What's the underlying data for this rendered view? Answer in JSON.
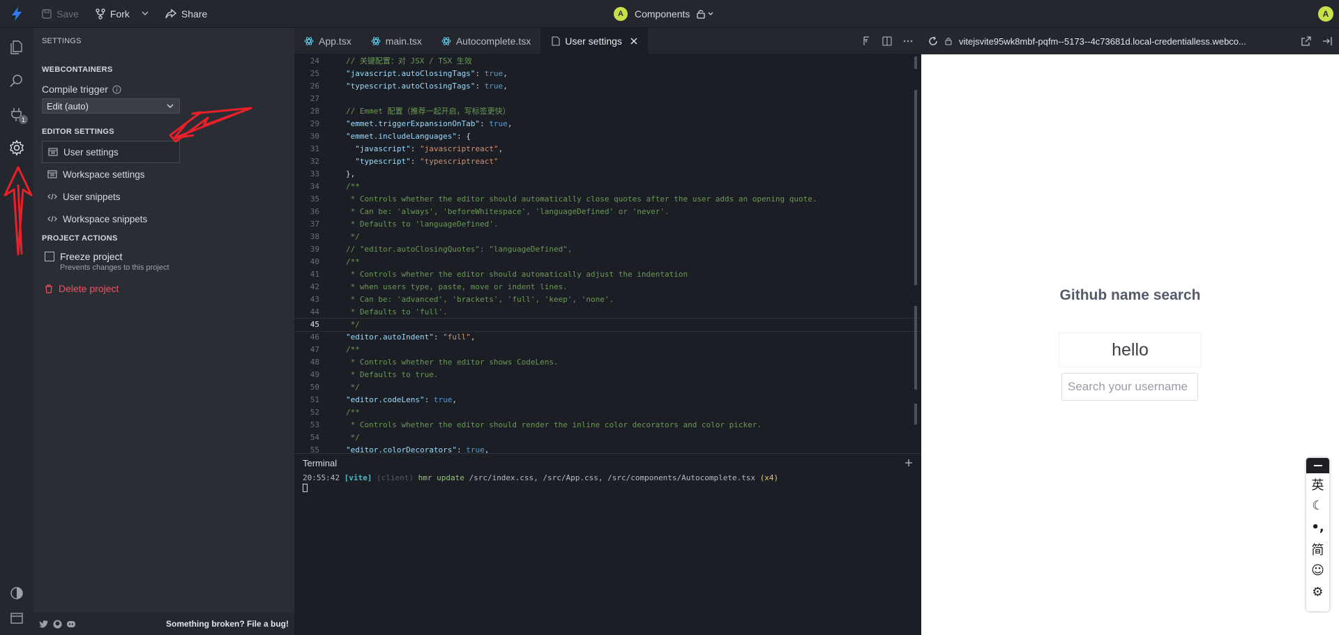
{
  "topbar": {
    "save_label": "Save",
    "fork_label": "Fork",
    "share_label": "Share",
    "project_avatar": "A",
    "project_name": "Components",
    "user_avatar": "A"
  },
  "activity": {
    "extensions_badge": "1"
  },
  "sidebar": {
    "title": "SETTINGS",
    "webcontainers_heading": "WEBCONTAINERS",
    "compile_trigger_label": "Compile trigger",
    "compile_trigger_value": "Edit (auto)",
    "editor_settings_heading": "EDITOR SETTINGS",
    "items": [
      {
        "label": "User settings"
      },
      {
        "label": "Workspace settings"
      },
      {
        "label": "User snippets"
      },
      {
        "label": "Workspace snippets"
      }
    ],
    "project_actions_heading": "PROJECT ACTIONS",
    "freeze_label": "Freeze project",
    "freeze_desc": "Prevents changes to this project",
    "delete_label": "Delete project",
    "footer_bug": "Something broken? File a bug!"
  },
  "tabs": [
    {
      "label": "App.tsx"
    },
    {
      "label": "main.tsx"
    },
    {
      "label": "Autocomplete.tsx"
    },
    {
      "label": "User settings"
    }
  ],
  "code_lines": [
    {
      "n": "24",
      "html": "<span class=\"c-com\">// 关键配置：对 JSX / TSX 生效</span>"
    },
    {
      "n": "25",
      "html": "<span class=\"c-key\">\"javascript.autoClosingTags\"</span>: <span class=\"c-bool\">true</span>,"
    },
    {
      "n": "26",
      "html": "<span class=\"c-key\">\"typescript.autoClosingTags\"</span>: <span class=\"c-bool\">true</span>,"
    },
    {
      "n": "27",
      "html": ""
    },
    {
      "n": "28",
      "html": "<span class=\"c-com\">// Emmet 配置（推荐一起开启，写标签更快）</span>"
    },
    {
      "n": "29",
      "html": "<span class=\"c-key\">\"emmet.triggerExpansionOnTab\"</span>: <span class=\"c-bool\">true</span>,"
    },
    {
      "n": "30",
      "html": "<span class=\"c-key\">\"emmet.includeLanguages\"</span>: {"
    },
    {
      "n": "31",
      "html": "  <span class=\"c-key\">\"javascript\"</span>: <span class=\"c-str\">\"javascriptreact\"</span>,"
    },
    {
      "n": "32",
      "html": "  <span class=\"c-key\">\"typescript\"</span>: <span class=\"c-str\">\"typescriptreact\"</span>"
    },
    {
      "n": "33",
      "html": "},"
    },
    {
      "n": "34",
      "html": "<span class=\"c-com\">/**</span>"
    },
    {
      "n": "35",
      "html": "<span class=\"c-com\"> * Controls whether the editor should automatically close quotes after the user adds an opening quote.</span>"
    },
    {
      "n": "36",
      "html": "<span class=\"c-com\"> * Can be: 'always', 'beforeWhitespace', 'languageDefined' or 'never'.</span>"
    },
    {
      "n": "37",
      "html": "<span class=\"c-com\"> * Defaults to 'languageDefined'.</span>"
    },
    {
      "n": "38",
      "html": "<span class=\"c-com\"> */</span>"
    },
    {
      "n": "39",
      "html": "<span class=\"c-com\">// \"editor.autoClosingQuotes\": \"languageDefined\",</span>"
    },
    {
      "n": "40",
      "html": "<span class=\"c-com\">/**</span>"
    },
    {
      "n": "41",
      "html": "<span class=\"c-com\"> * Controls whether the editor should automatically adjust the indentation</span>"
    },
    {
      "n": "42",
      "html": "<span class=\"c-com\"> * when users type, paste, move or indent lines.</span>"
    },
    {
      "n": "43",
      "html": "<span class=\"c-com\"> * Can be: 'advanced', 'brackets', 'full', 'keep', 'none'.</span>"
    },
    {
      "n": "44",
      "html": "<span class=\"c-com\"> * Defaults to 'full'.</span>"
    },
    {
      "n": "45",
      "html": "<span class=\"c-com\"> */</span>"
    },
    {
      "n": "46",
      "html": "<span class=\"c-key\">\"editor.autoIndent\"</span>: <span class=\"c-str\">\"full\"</span>,"
    },
    {
      "n": "47",
      "html": "<span class=\"c-com\">/**</span>"
    },
    {
      "n": "48",
      "html": "<span class=\"c-com\"> * Controls whether the editor shows CodeLens.</span>"
    },
    {
      "n": "49",
      "html": "<span class=\"c-com\"> * Defaults to true.</span>"
    },
    {
      "n": "50",
      "html": "<span class=\"c-com\"> */</span>"
    },
    {
      "n": "51",
      "html": "<span class=\"c-key\">\"editor.codeLens\"</span>: <span class=\"c-bool\">true</span>,"
    },
    {
      "n": "52",
      "html": "<span class=\"c-com\">/**</span>"
    },
    {
      "n": "53",
      "html": "<span class=\"c-com\"> * Controls whether the editor should render the inline color decorators and color picker.</span>"
    },
    {
      "n": "54",
      "html": "<span class=\"c-com\"> */</span>"
    },
    {
      "n": "55",
      "html": "<span class=\"c-key\">\"editor.colorDecorators\"</span>: <span class=\"c-bool\">true</span>,"
    }
  ],
  "current_line": "45",
  "terminal": {
    "title": "Terminal",
    "time": "20:55:42",
    "vite": "[vite]",
    "client": "(client)",
    "hmr": "hmr update",
    "paths": "/src/index.css, /src/App.css, /src/components/Autocomplete.tsx",
    "count": "(x4)"
  },
  "preview": {
    "url": "vitejsvite95wk8mbf-pqfm--5173--4c73681d.local-credentialless.webco...",
    "heading": "Github name search",
    "hello": "hello",
    "input_placeholder": "Search your username"
  },
  "ime": {
    "items": [
      "英",
      "☾",
      "•,",
      "简",
      "☺",
      "⚙"
    ]
  },
  "colors": {
    "accent": "#2f7df6",
    "annotation": "#e8202a",
    "delete": "#f0525f"
  }
}
